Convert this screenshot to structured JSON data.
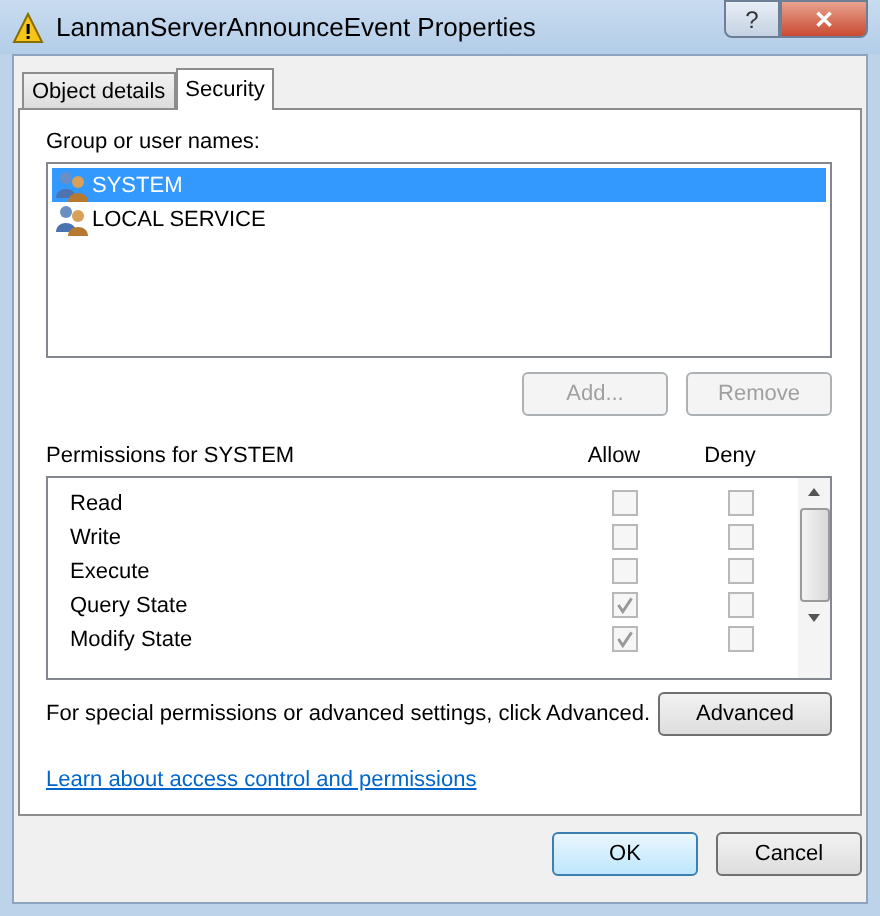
{
  "window": {
    "title": "LanmanServerAnnounceEvent Properties",
    "help": "?",
    "close": "✕"
  },
  "tabs": [
    {
      "label": "Object details",
      "selected": false
    },
    {
      "label": "Security",
      "selected": true
    }
  ],
  "group_label": "Group or user names:",
  "users": [
    {
      "name": "SYSTEM",
      "selected": true
    },
    {
      "name": "LOCAL SERVICE",
      "selected": false
    }
  ],
  "user_buttons": [
    {
      "label": "Add...",
      "disabled": true
    },
    {
      "label": "Remove",
      "disabled": true
    }
  ],
  "permissions_label": "Permissions for SYSTEM",
  "columns": [
    "Allow",
    "Deny"
  ],
  "permissions": [
    {
      "name": "Read",
      "allow": false,
      "deny": false
    },
    {
      "name": "Write",
      "allow": false,
      "deny": false
    },
    {
      "name": "Execute",
      "allow": false,
      "deny": false
    },
    {
      "name": "Query State",
      "allow": true,
      "deny": false
    },
    {
      "name": "Modify State",
      "allow": true,
      "deny": false
    }
  ],
  "advanced_text": "For special permissions or advanced settings, click Advanced.",
  "advanced_button": "Advanced",
  "link": "Learn about access control and permissions",
  "buttons": [
    {
      "label": "OK",
      "default": true
    },
    {
      "label": "Cancel",
      "default": false
    }
  ]
}
